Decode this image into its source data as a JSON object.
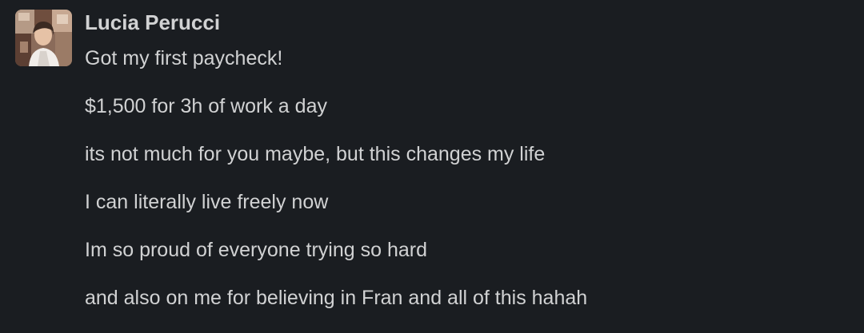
{
  "message": {
    "sender": "Lucia Perucci",
    "lines": [
      "Got my first paycheck!",
      "$1,500 for 3h of work a day",
      "its not much for you maybe, but this changes my life",
      "I can literally live freely now",
      "Im so proud of everyone trying so hard",
      "and also on me for believing in Fran and all of this hahah"
    ]
  },
  "colors": {
    "background": "#1a1d21",
    "text": "#d1d2d3"
  },
  "icons": {
    "avatar": "user-avatar-photo"
  }
}
